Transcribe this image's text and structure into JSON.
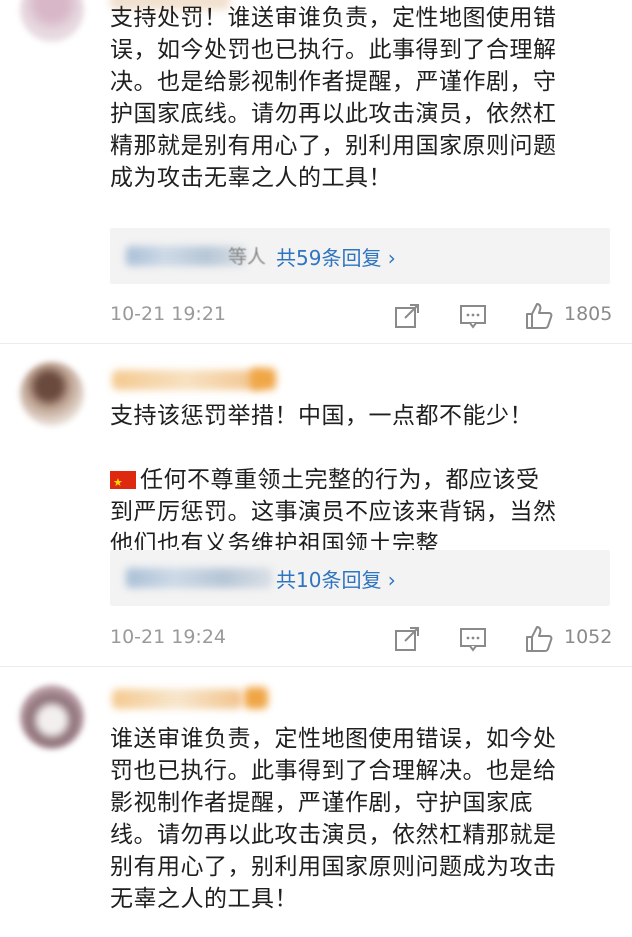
{
  "comments": [
    {
      "text": "支持处罚！谁送审谁负责，定性地图使用错\n误，如今处罚也已执行。此事得到了合理解\n决。也是给影视制作者提醒，严谨作剧，守\n护国家底线。请勿再以此攻击演员，依然杠\n精那就是别有用心了，别利用国家原则问题\n成为攻击无辜之人的工具！",
      "reply_who_suffix": "等人",
      "reply_link": "共59条回复 ›",
      "time": "10-21 19:21",
      "likes": "1805"
    },
    {
      "text_line1": "支持该惩罚举措！中国，一点都不能少！",
      "text_rest": "任何不尊重领土完整的行为，都应该受\n到严厉惩罚。这事演员不应该来背锅，当然\n他们也有义务维护祖国领土完整",
      "reply_link": "共10条回复 ›",
      "time": "10-21 19:24",
      "likes": "1052"
    },
    {
      "text": "谁送审谁负责，定性地图使用错误，如今处\n罚也已执行。此事得到了合理解决。也是给\n影视制作者提醒，严谨作剧，守护国家底\n线。请勿再以此攻击演员，依然杠精那就是\n别有用心了，别利用国家原则问题成为攻击\n无辜之人的工具！"
    }
  ],
  "icons": {
    "share": "share-icon",
    "comment": "comment-icon",
    "like": "thumbs-up-icon",
    "flag": "china-flag-emoji"
  },
  "colors": {
    "link": "#2f74c0",
    "meta": "#9a9a9a"
  }
}
